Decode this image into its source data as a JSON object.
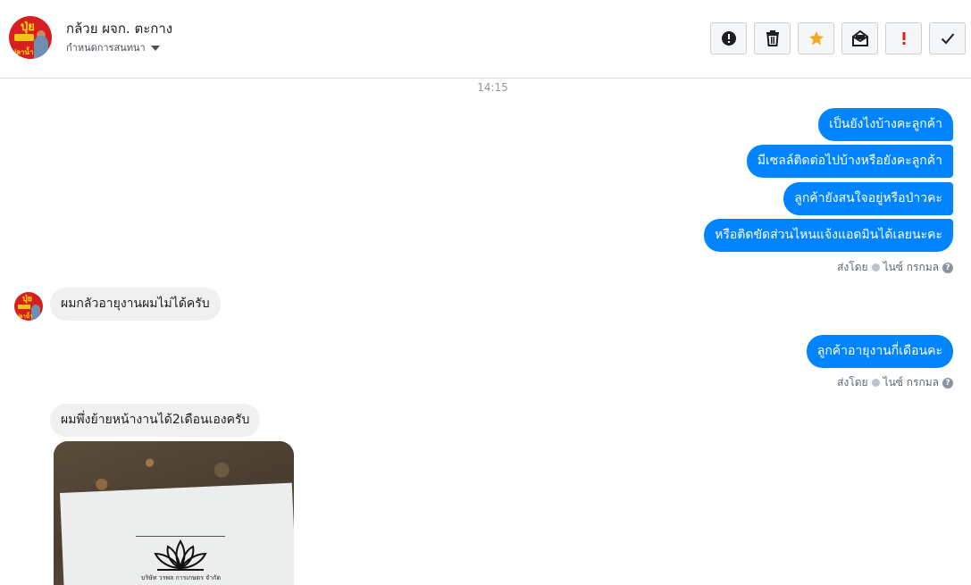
{
  "header": {
    "contact_name": "กล้วย ผจก. ตะกาง",
    "contact_sub": "กำหนดการสนทนา",
    "toolbar": [
      {
        "name": "report-button",
        "icon": "alert-circle-icon"
      },
      {
        "name": "delete-button",
        "icon": "trash-icon"
      },
      {
        "name": "star-button",
        "icon": "star-icon"
      },
      {
        "name": "mark-unread-button",
        "icon": "envelope-open-icon"
      },
      {
        "name": "important-button",
        "icon": "exclamation-icon"
      },
      {
        "name": "mark-done-button",
        "icon": "checkmark-icon"
      }
    ]
  },
  "conversation": {
    "timestamp": "14:15",
    "outgoing_group_1": [
      "เป็นยังไงบ้างคะลูกค้า",
      "มีเซลล์ติดต่อไปบ้างหรือยังคะลูกค้า",
      "ลูกค้ายังสนใจอยู่หรือป่าวคะ",
      "หรือติดขัดส่วนไหนแจ้งแอดมินได้เลยนะคะ"
    ],
    "sent_by_1": {
      "prefix": "ส่งโดย",
      "name": "ไนซ์ กรกมล"
    },
    "incoming_1": "ผมกลัวอายุงานผมไม่ได้ครับ",
    "outgoing_group_2": [
      "ลูกค้าอายุงานกี่เดือนคะ"
    ],
    "sent_by_2": {
      "prefix": "ส่งโดย",
      "name": "ไนซ์ กรกมล"
    },
    "incoming_2": "ผมพึ่งย้ายหน้างานได้2เดือนเองครับ",
    "photo_caption": "บริษัท วรพล การเกษตร จำกัด"
  },
  "colors": {
    "outgoing_bubble": "#0084ff",
    "incoming_bubble": "#f1f0f0",
    "star": "#f5a623",
    "important": "#e02020"
  }
}
